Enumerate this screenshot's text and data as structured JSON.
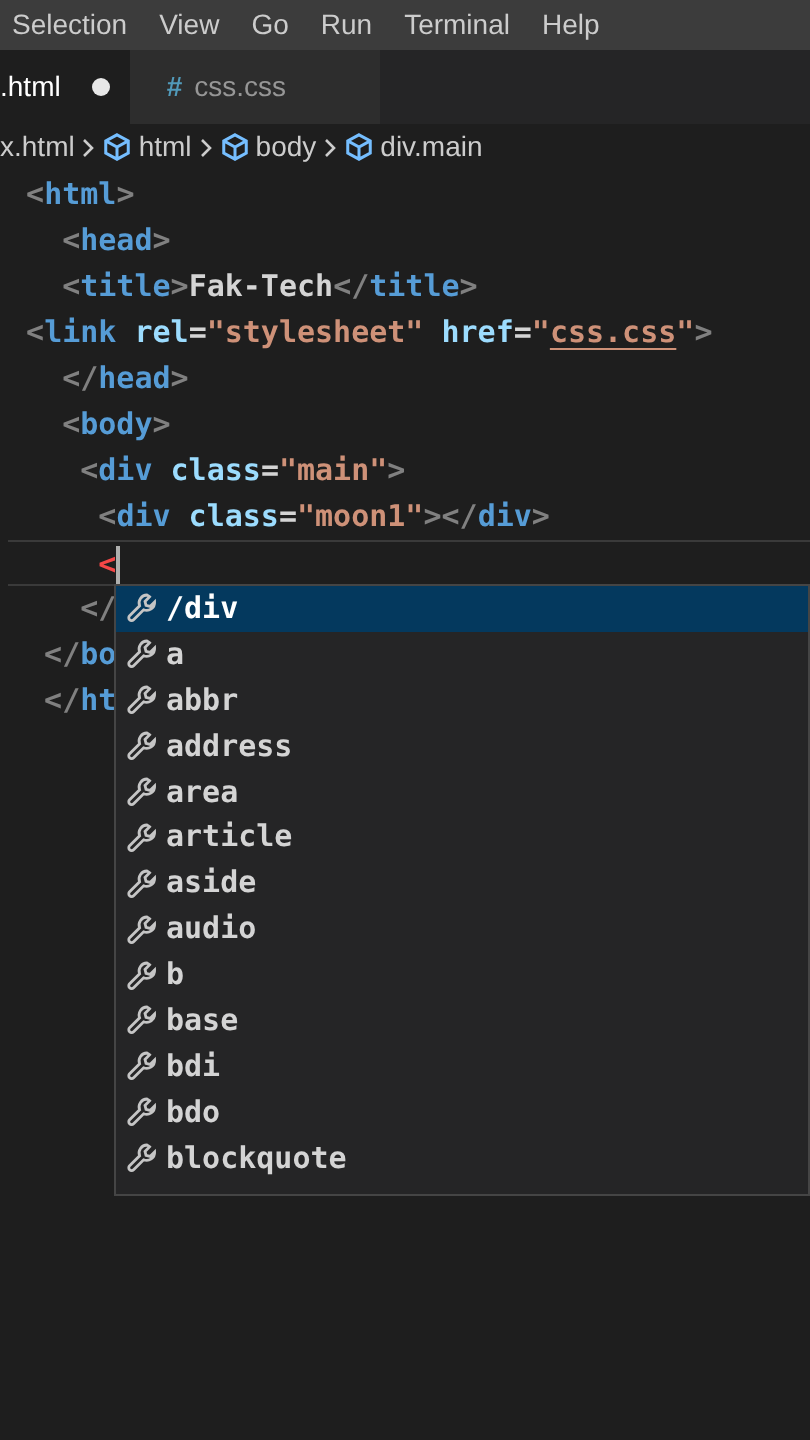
{
  "menu_bar": {
    "items": [
      "Selection",
      "View",
      "Go",
      "Run",
      "Terminal",
      "Help"
    ]
  },
  "tabs": [
    {
      "label": ".html",
      "selected": true,
      "modified": true
    },
    {
      "icon": "#",
      "label": "css.css",
      "selected": false,
      "modified": false
    }
  ],
  "breadcrumb": [
    {
      "label": "x.html",
      "kind": "file"
    },
    {
      "label": "html",
      "kind": "element"
    },
    {
      "label": "body",
      "kind": "element"
    },
    {
      "label": "div.main",
      "kind": "element"
    }
  ],
  "editor": {
    "lines": [
      {
        "current": false,
        "tokens": [
          {
            "kind": "punct",
            "text": " <"
          },
          {
            "kind": "tag",
            "text": "html"
          },
          {
            "kind": "punct",
            "text": ">"
          }
        ]
      },
      {
        "current": false,
        "tokens": [
          {
            "kind": "punct",
            "text": "   <"
          },
          {
            "kind": "tag",
            "text": "head"
          },
          {
            "kind": "punct",
            "text": ">"
          }
        ]
      },
      {
        "current": false,
        "tokens": [
          {
            "kind": "punct",
            "text": "   <"
          },
          {
            "kind": "tag",
            "text": "title"
          },
          {
            "kind": "punct",
            "text": ">"
          },
          {
            "kind": "text",
            "text": "Fak-Tech"
          },
          {
            "kind": "punct",
            "text": "</"
          },
          {
            "kind": "tag",
            "text": "title"
          },
          {
            "kind": "punct",
            "text": ">"
          }
        ]
      },
      {
        "current": false,
        "tokens": [
          {
            "kind": "punct",
            "text": " <"
          },
          {
            "kind": "tag",
            "text": "link"
          },
          {
            "kind": "attr",
            "text": " rel"
          },
          {
            "kind": "text",
            "text": "="
          },
          {
            "kind": "string",
            "text": "\"stylesheet\""
          },
          {
            "kind": "attr",
            "text": " href"
          },
          {
            "kind": "text",
            "text": "="
          },
          {
            "kind": "string",
            "text": "\""
          },
          {
            "kind": "link",
            "text": "css.css"
          },
          {
            "kind": "string",
            "text": "\""
          },
          {
            "kind": "punct",
            "text": ">"
          }
        ]
      },
      {
        "current": false,
        "tokens": [
          {
            "kind": "punct",
            "text": "   </"
          },
          {
            "kind": "tag",
            "text": "head"
          },
          {
            "kind": "punct",
            "text": ">"
          }
        ]
      },
      {
        "current": false,
        "tokens": [
          {
            "kind": "punct",
            "text": "   <"
          },
          {
            "kind": "tag",
            "text": "body"
          },
          {
            "kind": "punct",
            "text": ">"
          }
        ]
      },
      {
        "current": false,
        "tokens": [
          {
            "kind": "punct",
            "text": "    <"
          },
          {
            "kind": "tag",
            "text": "div"
          },
          {
            "kind": "attr",
            "text": " class"
          },
          {
            "kind": "text",
            "text": "="
          },
          {
            "kind": "string",
            "text": "\"main\""
          },
          {
            "kind": "punct",
            "text": ">"
          }
        ]
      },
      {
        "current": false,
        "tokens": [
          {
            "kind": "punct",
            "text": "     <"
          },
          {
            "kind": "tag",
            "text": "div"
          },
          {
            "kind": "attr",
            "text": " class"
          },
          {
            "kind": "text",
            "text": "="
          },
          {
            "kind": "string",
            "text": "\"moon1\""
          },
          {
            "kind": "punct",
            "text": "></"
          },
          {
            "kind": "tag",
            "text": "div"
          },
          {
            "kind": "punct",
            "text": ">"
          }
        ]
      },
      {
        "current": true,
        "tokens": [
          {
            "kind": "error",
            "text": "     <"
          }
        ]
      },
      {
        "current": false,
        "tokens": [
          {
            "kind": "punct",
            "text": "    </"
          }
        ]
      },
      {
        "current": false,
        "tokens": [
          {
            "kind": "punct",
            "text": "  </"
          },
          {
            "kind": "tag",
            "text": "bo"
          }
        ]
      },
      {
        "current": false,
        "tokens": [
          {
            "kind": "punct",
            "text": "  </"
          },
          {
            "kind": "tag",
            "text": "ht"
          }
        ]
      }
    ]
  },
  "suggestions": [
    {
      "label": "/div",
      "selected": true
    },
    {
      "label": "a",
      "selected": false
    },
    {
      "label": "abbr",
      "selected": false
    },
    {
      "label": "address",
      "selected": false
    },
    {
      "label": "area",
      "selected": false
    },
    {
      "label": "article",
      "selected": false
    },
    {
      "label": "aside",
      "selected": false
    },
    {
      "label": "audio",
      "selected": false
    },
    {
      "label": "b",
      "selected": false
    },
    {
      "label": "base",
      "selected": false
    },
    {
      "label": "bdi",
      "selected": false
    },
    {
      "label": "bdo",
      "selected": false
    },
    {
      "label": "blockquote",
      "selected": false
    }
  ]
}
